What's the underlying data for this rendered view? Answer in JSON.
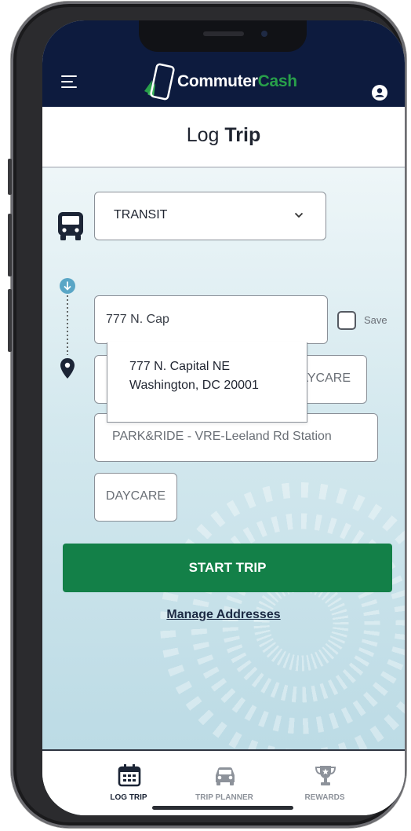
{
  "app": {
    "logo_part1": "Commuter",
    "logo_part2": "Cash",
    "colors": {
      "navy": "#0d1b3e",
      "brand_green": "#28a04a",
      "button_green": "#138048"
    }
  },
  "header": {
    "title_regular": "Log",
    "title_bold": "Trip",
    "menu_icon": "hamburger-icon",
    "profile_icon": "user-icon"
  },
  "mode": {
    "selected": "TRANSIT",
    "icon": "bus-icon"
  },
  "from": {
    "value": "777 N. Cap",
    "save_label": "Save"
  },
  "autocomplete": {
    "line1": "777 N. Capital NE",
    "line2": "Washington, DC 20001"
  },
  "saved_locations": [
    "DAYCARE",
    "PARK&RIDE - VRE-Leeland Rd Station",
    "DAYCARE"
  ],
  "actions": {
    "start_trip": "START TRIP",
    "manage_addresses": "Manage Addresses"
  },
  "tabs": [
    {
      "label": "LOG TRIP",
      "icon": "calendar-icon",
      "active": true
    },
    {
      "label": "TRIP PLANNER",
      "icon": "car-icon",
      "active": false
    },
    {
      "label": "REWARDS",
      "icon": "trophy-icon",
      "active": false
    }
  ]
}
